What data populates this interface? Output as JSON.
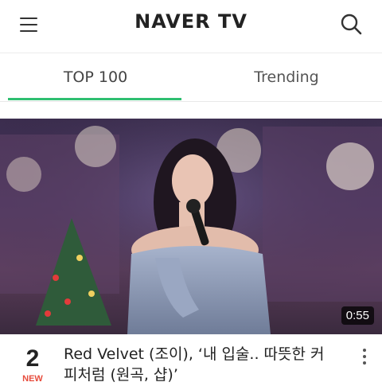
{
  "header": {
    "logo": "NAVER TV",
    "menu_icon": "hamburger-menu-icon",
    "search_icon": "search-icon"
  },
  "tabs": [
    {
      "label": "TOP 100",
      "active": true
    },
    {
      "label": "Trending",
      "active": false
    }
  ],
  "colors": {
    "accent": "#2fbf71",
    "new_badge": "#e74c3c"
  },
  "video": {
    "duration": "0:55"
  },
  "item": {
    "rank": "2",
    "badge": "NEW",
    "title": "Red Velvet (조이), ‘내 입술.. 따뜻한 커피처럼 (원곡, 샵)’",
    "more_icon": "more-vertical-icon"
  }
}
